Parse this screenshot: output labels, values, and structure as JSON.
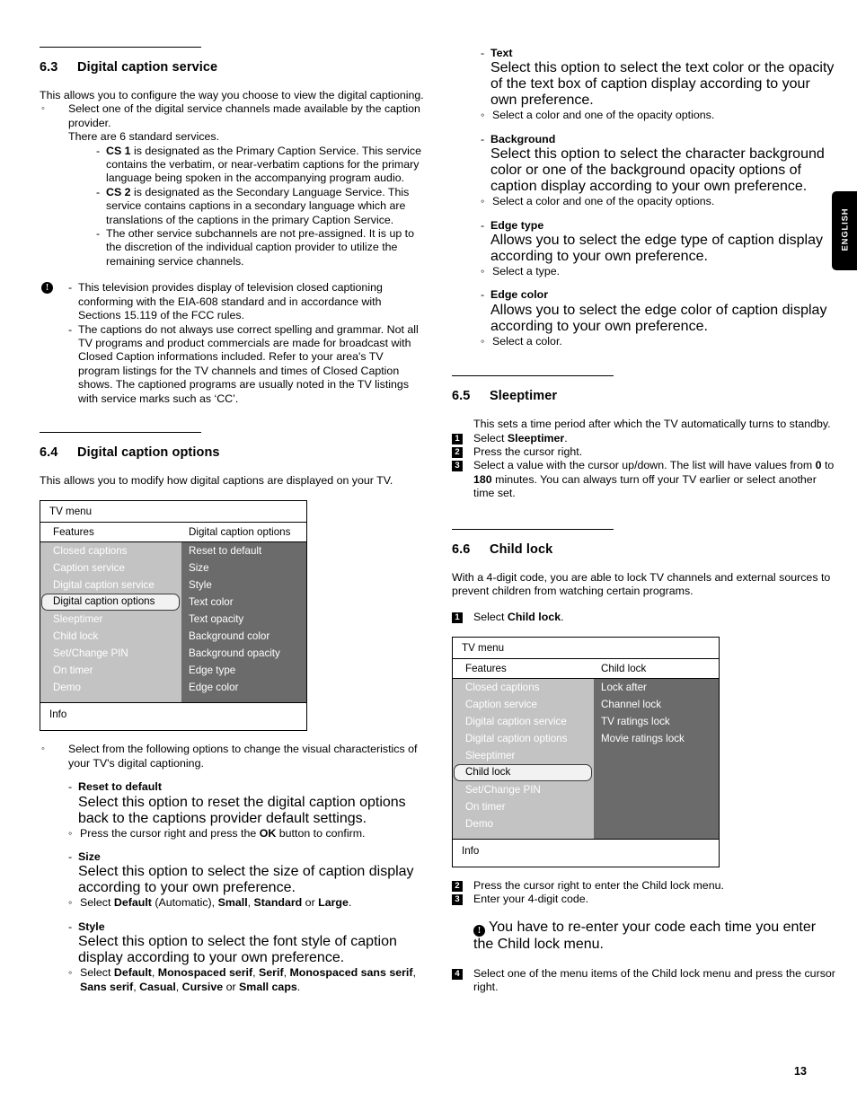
{
  "page": {
    "number": "13",
    "language_tab": "ENGLISH"
  },
  "left_column": {
    "section_63": {
      "number": "6.3",
      "title": "Digital caption service",
      "intro": "This allows you to configure the way you choose to view the digital captioning.",
      "bullet": {
        "marker": "◦",
        "line1": "Select one of the digital service channels made available by the caption provider.",
        "line2": "There are 6 standard services."
      },
      "dashes": [
        {
          "marker": "-",
          "bold": "CS 1",
          "text": " is designated as the Primary Caption Service. This service contains the verbatim, or near-verbatim captions for the primary language being spoken in the accompanying program audio."
        },
        {
          "marker": "-",
          "bold": "CS 2",
          "text": " is designated as the Secondary Language Service. This service contains captions in a secondary language which are translations of the captions in the primary Caption Service."
        },
        {
          "marker": "-",
          "bold": "",
          "text": "The other service subchannels are not pre-assigned. It is up to the discretion of the individual caption provider to utilize the remaining service channels."
        }
      ],
      "note": {
        "icon": "warning-icon",
        "items": [
          "This television provides display of television closed captioning conforming with the EIA-608 standard and in accordance with Sections 15.119 of the FCC rules.",
          "The captions do not always use correct spelling and grammar. Not all TV programs and product commercials are made for broadcast with Closed Caption informations included. Refer to your area's TV program listings for the TV channels and times of Closed Caption shows. The captioned programs are usually noted in the TV listings with service marks such as ‘CC’."
        ]
      }
    },
    "section_64": {
      "number": "6.4",
      "title": "Digital caption options",
      "intro": "This allows you to modify how digital captions are displayed on your TV.",
      "menu": {
        "title": "TV menu",
        "col1_header": "Features",
        "col2_header": "Digital caption options",
        "info_label": "Info",
        "left_items": [
          {
            "label": "Closed captions",
            "selected": false
          },
          {
            "label": "Caption service",
            "selected": false
          },
          {
            "label": "Digital caption service",
            "selected": false
          },
          {
            "label": "Digital caption options",
            "selected": true
          },
          {
            "label": "Sleeptimer",
            "selected": false
          },
          {
            "label": "Child lock",
            "selected": false
          },
          {
            "label": "Set/Change PIN",
            "selected": false
          },
          {
            "label": "On timer",
            "selected": false
          },
          {
            "label": "Demo",
            "selected": false
          }
        ],
        "right_items": [
          {
            "label": "Reset to default"
          },
          {
            "label": "Size"
          },
          {
            "label": "Style"
          },
          {
            "label": "Text color"
          },
          {
            "label": "Text opacity"
          },
          {
            "label": "Background color"
          },
          {
            "label": "Background opacity"
          },
          {
            "label": "Edge type"
          },
          {
            "label": "Edge color"
          }
        ]
      },
      "options_intro": "Select from the following options to change the visual characteristics of your TV's digital captioning.",
      "options": [
        {
          "title": "Reset to default",
          "desc": "Select this option to reset the digital caption options back to the captions provider default settings.",
          "action_prefix": "Press the cursor right and press the ",
          "action_bold": "OK",
          "action_suffix": " button to confirm."
        },
        {
          "title": "Size",
          "desc": "Select this option to select the size of caption display according to your own preference.",
          "action_html": "Select <b>Default</b> (Automatic), <b>Small</b>, <b>Standard</b> or <b>Large</b>."
        },
        {
          "title": "Style",
          "desc": "Select this option to select the font style of caption display according to your own preference.",
          "action_html": "Select <b>Default</b>, <b>Monospaced serif</b>, <b>Serif</b>, <b>Monospaced sans serif</b>, <b>Sans serif</b>, <b>Casual</b>, <b>Cursive</b> or <b>Small caps</b>."
        }
      ]
    }
  },
  "right_column": {
    "options_continued": [
      {
        "title": "Text",
        "desc": "Select this option to select the text color or the opacity of the text box of caption display according to your own preference.",
        "action": "Select a color and one of the opacity options."
      },
      {
        "title": "Background",
        "desc": "Select this option to select the character background color or one of the background opacity options of caption display according to your own preference.",
        "action": "Select a color and one of the opacity options."
      },
      {
        "title": "Edge type",
        "desc": "Allows you to select the edge type of caption display according to your own preference.",
        "action": "Select a type."
      },
      {
        "title": "Edge color",
        "desc": "Allows you to select the edge color of caption display according to your own preference.",
        "action": "Select a color."
      }
    ],
    "section_65": {
      "number": "6.5",
      "title": "Sleeptimer",
      "intro": "This sets a time period after which the TV automatically turns to standby.",
      "steps": [
        {
          "n": "1",
          "html": "Select <b>Sleeptimer</b>."
        },
        {
          "n": "2",
          "html": "Press the cursor right."
        },
        {
          "n": "3",
          "html": "Select a value with the cursor up/down. The list will have values from <b>0</b> to <b>180</b> minutes. You can always turn off your TV earlier or select another time set."
        }
      ]
    },
    "section_66": {
      "number": "6.6",
      "title": "Child lock",
      "intro": "With a 4-digit code, you are able to lock TV channels and external sources to prevent children from watching certain programs.",
      "step1": {
        "n": "1",
        "html": "Select <b>Child lock</b>."
      },
      "menu": {
        "title": "TV menu",
        "col1_header": "Features",
        "col2_header": "Child lock",
        "info_label": "Info",
        "left_items": [
          {
            "label": "Closed captions",
            "selected": false
          },
          {
            "label": "Caption service",
            "selected": false
          },
          {
            "label": "Digital caption service",
            "selected": false
          },
          {
            "label": "Digital caption options",
            "selected": false
          },
          {
            "label": "Sleeptimer",
            "selected": false
          },
          {
            "label": "Child lock",
            "selected": true
          },
          {
            "label": "Set/Change PIN",
            "selected": false
          },
          {
            "label": "On timer",
            "selected": false
          },
          {
            "label": "Demo",
            "selected": false
          }
        ],
        "right_items": [
          {
            "label": "Lock after"
          },
          {
            "label": "Channel lock"
          },
          {
            "label": "TV ratings lock"
          },
          {
            "label": "Movie ratings lock"
          },
          {
            "label": ""
          },
          {
            "label": ""
          },
          {
            "label": ""
          },
          {
            "label": ""
          },
          {
            "label": ""
          }
        ]
      },
      "steps_after": [
        {
          "n": "2",
          "html": "Press the cursor right to enter the Child lock menu."
        },
        {
          "n": "3",
          "html": "Enter your 4-digit code."
        }
      ],
      "note": "You have to re-enter your code each time you enter the Child lock menu.",
      "step4": {
        "n": "4",
        "html": "Select one of the menu items of the Child lock menu and press the cursor right."
      }
    }
  },
  "colors": {
    "menu_left_bg": "#c3c3c3",
    "menu_right_bg": "#6b6b6b",
    "menu_selected_bg": "#f2f2f2",
    "text": "#000000",
    "tab_bg": "#000000"
  }
}
